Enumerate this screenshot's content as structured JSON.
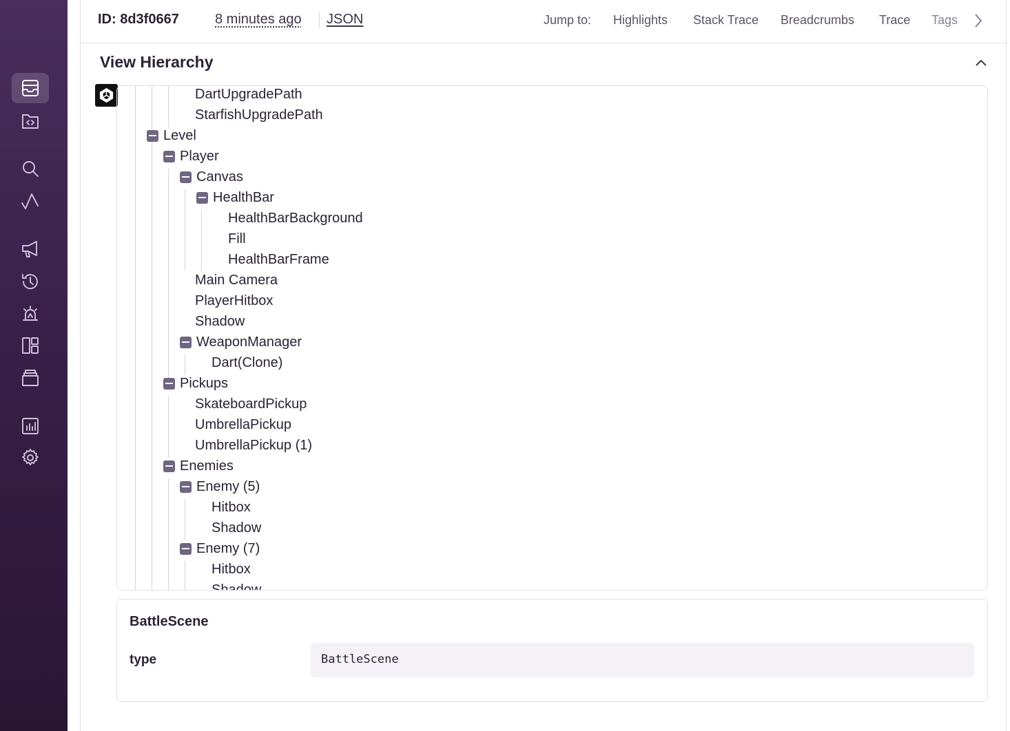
{
  "header": {
    "event_id": "ID: 8d3f0667",
    "time_ago": "8 minutes ago",
    "json_link": "JSON",
    "jump_to_label": "Jump to:",
    "jump_links": [
      "Highlights",
      "Stack Trace",
      "Breadcrumbs",
      "Trace",
      "Tags"
    ]
  },
  "sidebar": {
    "items": [
      {
        "icon": "issues-icon",
        "active": true
      },
      {
        "icon": "projects-icon",
        "active": false
      },
      {
        "icon": "search-icon",
        "active": false
      },
      {
        "icon": "performance-icon",
        "active": false
      },
      {
        "icon": "releases-icon",
        "active": false
      },
      {
        "icon": "history-icon",
        "active": false
      },
      {
        "icon": "alerts-icon",
        "active": false
      },
      {
        "icon": "dashboards-icon",
        "active": false
      },
      {
        "icon": "discover-icon",
        "active": false
      },
      {
        "icon": "stats-icon",
        "active": false
      },
      {
        "icon": "settings-icon",
        "active": false
      }
    ]
  },
  "section": {
    "title": "View Hierarchy",
    "platform_icon": "unity-icon"
  },
  "tree": {
    "nodes": [
      {
        "label": "DartUpgradePath",
        "collapsible": false
      },
      {
        "label": "StarfishUpgradePath",
        "collapsible": false
      },
      {
        "label": "Level",
        "collapsible": true
      },
      {
        "label": "Player",
        "collapsible": true
      },
      {
        "label": "Canvas",
        "collapsible": true
      },
      {
        "label": "HealthBar",
        "collapsible": true
      },
      {
        "label": "HealthBarBackground",
        "collapsible": false
      },
      {
        "label": "Fill",
        "collapsible": false
      },
      {
        "label": "HealthBarFrame",
        "collapsible": false
      },
      {
        "label": "Main Camera",
        "collapsible": false
      },
      {
        "label": "PlayerHitbox",
        "collapsible": false
      },
      {
        "label": "Shadow",
        "collapsible": false
      },
      {
        "label": "WeaponManager",
        "collapsible": true
      },
      {
        "label": "Dart(Clone)",
        "collapsible": false
      },
      {
        "label": "Pickups",
        "collapsible": true
      },
      {
        "label": "SkateboardPickup",
        "collapsible": false
      },
      {
        "label": "UmbrellaPickup",
        "collapsible": false
      },
      {
        "label": "UmbrellaPickup (1)",
        "collapsible": false
      },
      {
        "label": "Enemies",
        "collapsible": true
      },
      {
        "label": "Enemy (5)",
        "collapsible": true
      },
      {
        "label": "Hitbox",
        "collapsible": false
      },
      {
        "label": "Shadow",
        "collapsible": false
      },
      {
        "label": "Enemy (7)",
        "collapsible": true
      },
      {
        "label": "Hitbox",
        "collapsible": false
      },
      {
        "label": "Shadow",
        "collapsible": false
      }
    ]
  },
  "details": {
    "title": "BattleScene",
    "key": "type",
    "value": "BattleScene"
  }
}
